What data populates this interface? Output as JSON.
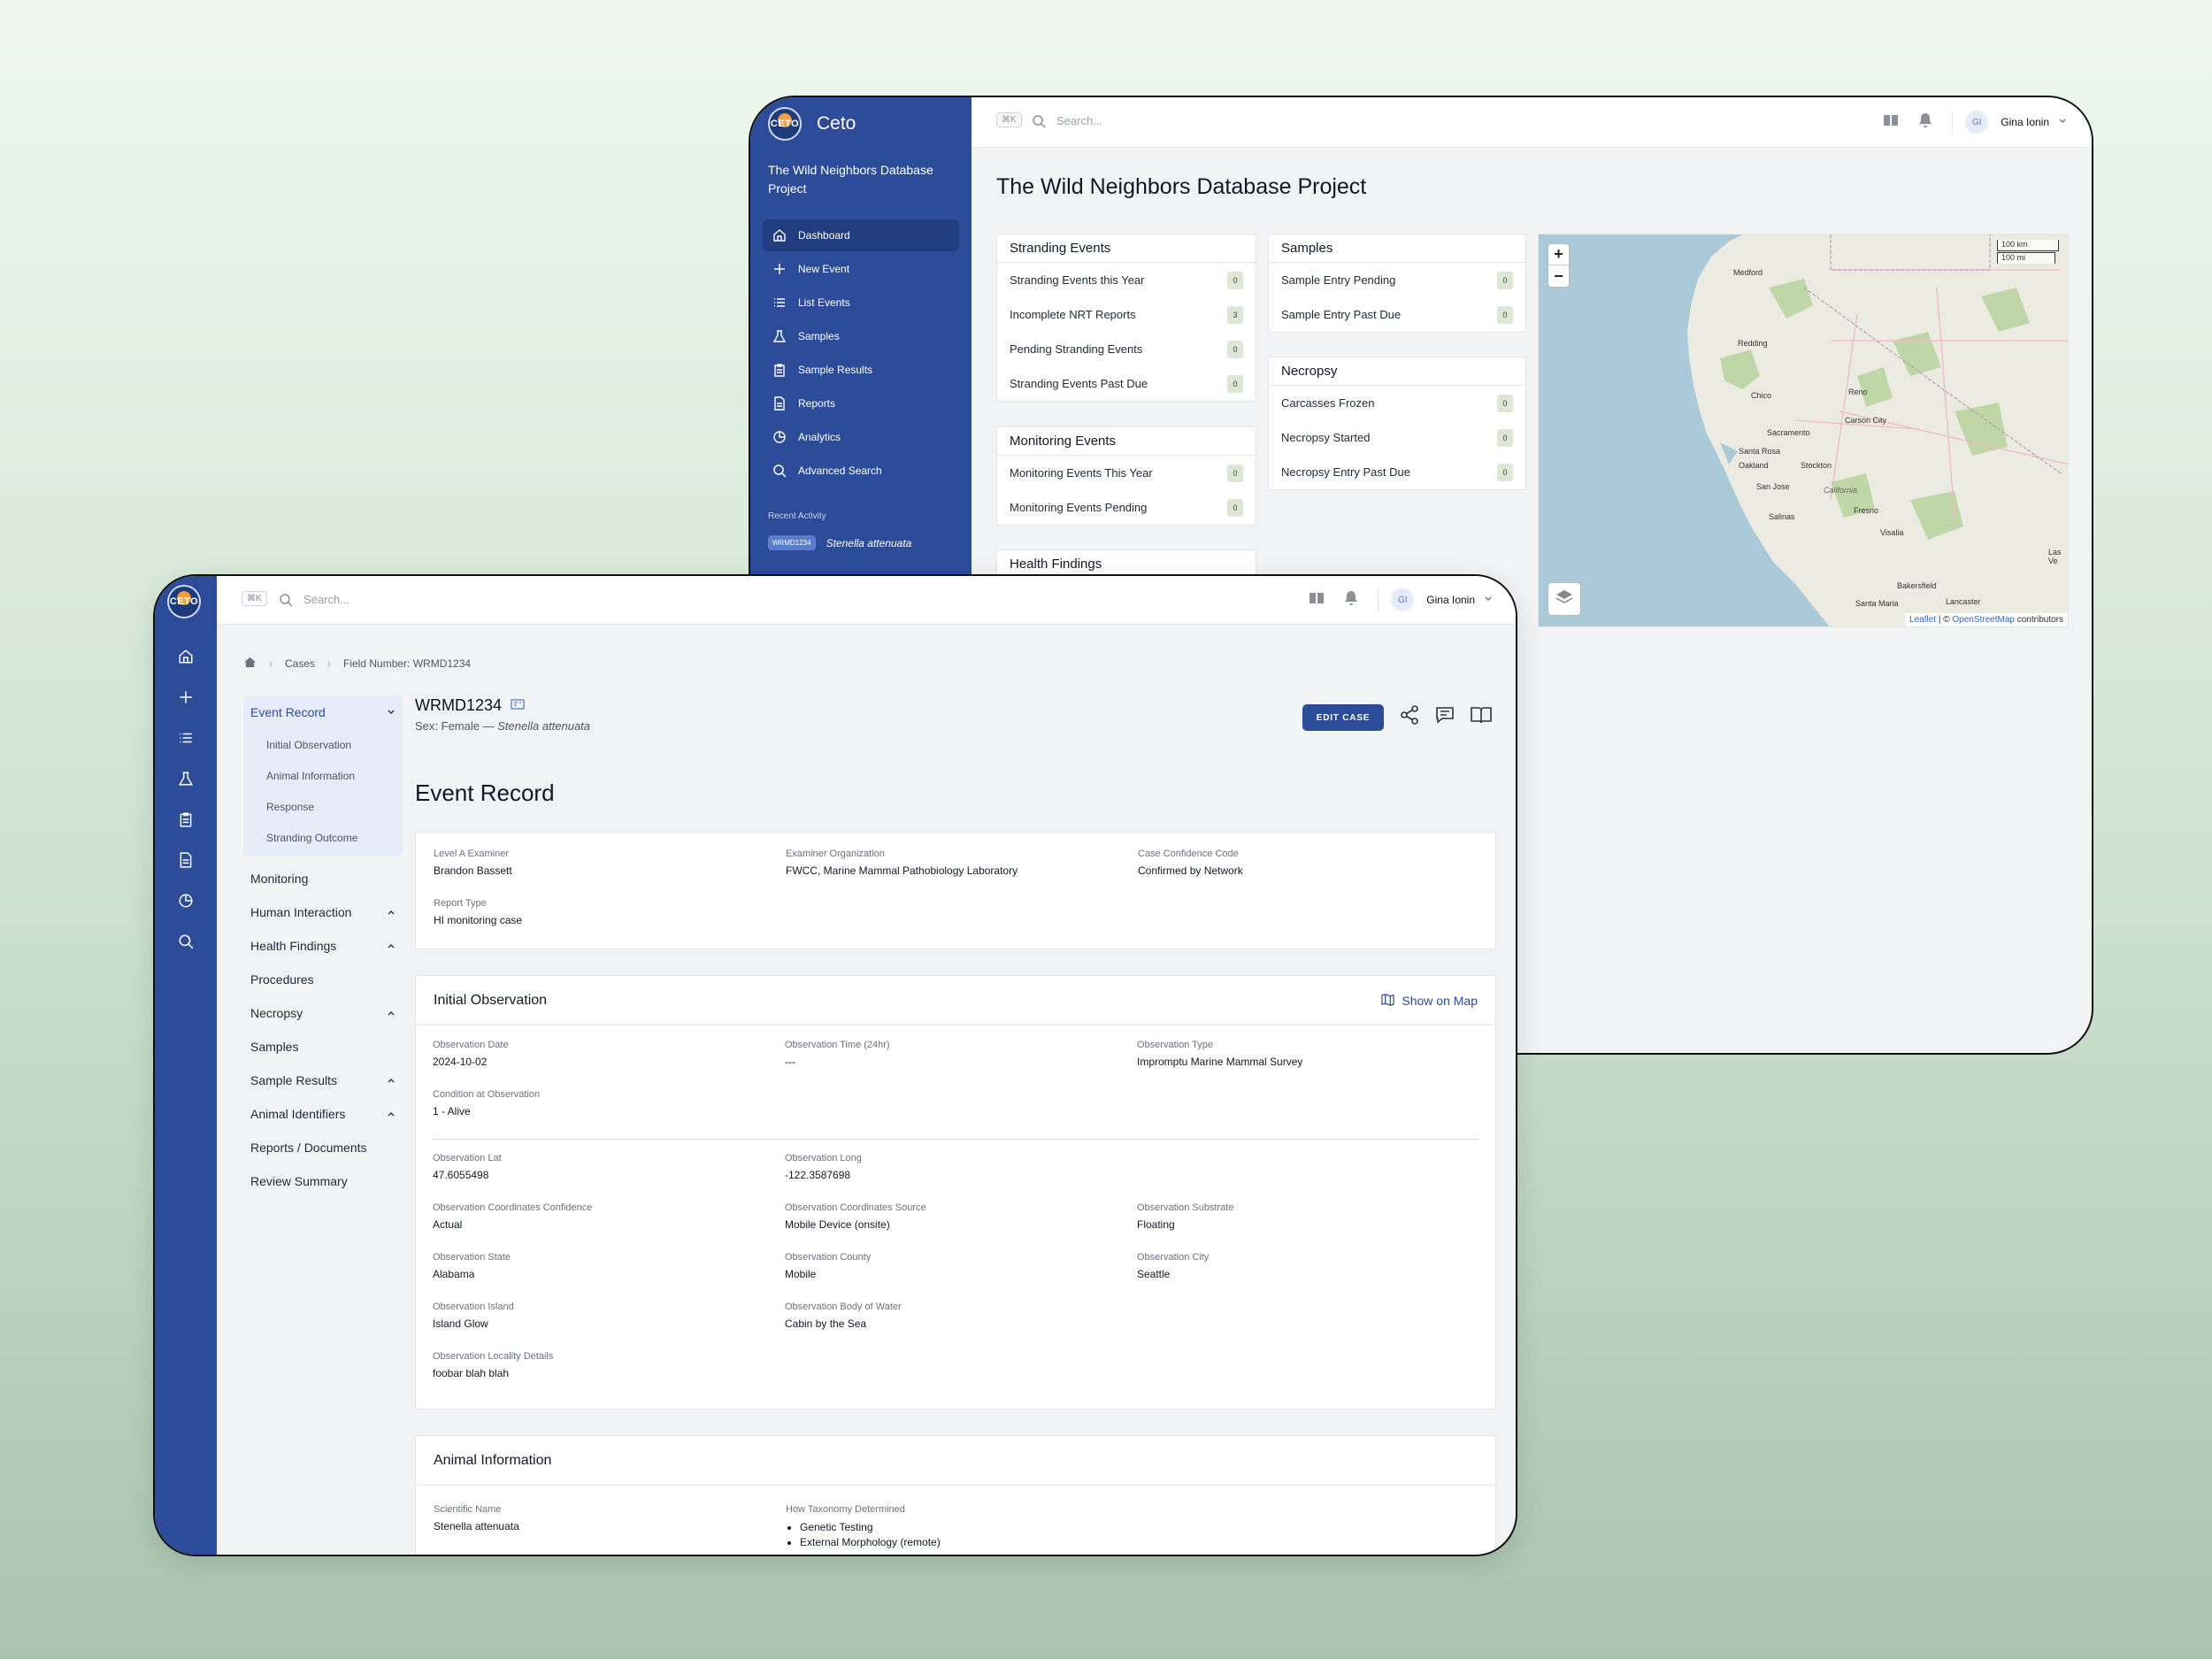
{
  "app": {
    "name": "Ceto",
    "logo_text": "CETO",
    "project": "The Wild Neighbors Database Project"
  },
  "search": {
    "shortcut": "⌘K",
    "placeholder": "Search..."
  },
  "user": {
    "initials": "GI",
    "name": "Gina Ionin"
  },
  "sidebar": {
    "items": [
      {
        "label": "Dashboard",
        "icon": "home-icon"
      },
      {
        "label": "New Event",
        "icon": "plus-icon"
      },
      {
        "label": "List Events",
        "icon": "list-icon"
      },
      {
        "label": "Samples",
        "icon": "flask-icon"
      },
      {
        "label": "Sample Results",
        "icon": "clipboard-icon"
      },
      {
        "label": "Reports",
        "icon": "document-icon"
      },
      {
        "label": "Analytics",
        "icon": "pie-chart-icon"
      },
      {
        "label": "Advanced Search",
        "icon": "search-icon"
      }
    ],
    "recent_heading": "Recent Activity",
    "recent": {
      "tag": "WRMD1234",
      "species": "Stenella attenuata"
    }
  },
  "dashboard": {
    "title": "The Wild Neighbors Database Project",
    "stranding": {
      "title": "Stranding Events",
      "rows": [
        {
          "label": "Stranding Events this Year",
          "count": "0"
        },
        {
          "label": "Incomplete NRT Reports",
          "count": "3"
        },
        {
          "label": "Pending Stranding Events",
          "count": "0"
        },
        {
          "label": "Stranding Events Past Due",
          "count": "0"
        }
      ]
    },
    "monitoring": {
      "title": "Monitoring Events",
      "rows": [
        {
          "label": "Monitoring Events This Year",
          "count": "0"
        },
        {
          "label": "Monitoring Events Pending",
          "count": "0"
        }
      ]
    },
    "health": {
      "title": "Health Findings"
    },
    "samples": {
      "title": "Samples",
      "rows": [
        {
          "label": "Sample Entry Pending",
          "count": "0"
        },
        {
          "label": "Sample Entry Past Due",
          "count": "0"
        }
      ]
    },
    "necropsy": {
      "title": "Necropsy",
      "rows": [
        {
          "label": "Carcasses Frozen",
          "count": "0"
        },
        {
          "label": "Necropsy Started",
          "count": "0"
        },
        {
          "label": "Necropsy Entry Past Due",
          "count": "0"
        }
      ]
    },
    "map": {
      "zoom_in": "+",
      "zoom_out": "−",
      "scale_km": "100 km",
      "scale_mi": "100 mi",
      "attr_leaflet": "Leaflet",
      "attr_sep": "| ©",
      "attr_osm": "OpenStreetMap",
      "attr_tail": "contributors",
      "cities": [
        "Medford",
        "Redding",
        "Chico",
        "Reno",
        "Carson City",
        "Sacramento",
        "Santa Rosa",
        "Oakland",
        "Stockton",
        "San Jose",
        "California",
        "Fresno",
        "Salinas",
        "Visalia",
        "Las Ve",
        "Bakersfield",
        "Santa Maria",
        "Lancaster"
      ]
    }
  },
  "case": {
    "breadcrumb": [
      "Cases",
      "Field Number: WRMD1234"
    ],
    "id": "WRMD1234",
    "sex": "Sex: Female —",
    "species": "Stenella attenuata",
    "edit_label": "EDIT CASE",
    "section_title": "Event Record",
    "nav": {
      "event_record": "Event Record",
      "event_subs": [
        "Initial Observation",
        "Animal Information",
        "Response",
        "Stranding Outcome"
      ],
      "items": [
        {
          "label": "Monitoring",
          "chev": ""
        },
        {
          "label": "Human Interaction",
          "chev": "⌃"
        },
        {
          "label": "Health Findings",
          "chev": "⌃"
        },
        {
          "label": "Procedures",
          "chev": ""
        },
        {
          "label": "Necropsy",
          "chev": "⌃"
        },
        {
          "label": "Samples",
          "chev": ""
        },
        {
          "label": "Sample Results",
          "chev": "⌃"
        },
        {
          "label": "Animal Identifiers",
          "chev": "⌃"
        },
        {
          "label": "Reports / Documents",
          "chev": ""
        },
        {
          "label": "Review Summary",
          "chev": ""
        }
      ]
    },
    "record": {
      "level_a_label": "Level A Examiner",
      "level_a": "Brandon Bassett",
      "org_label": "Examiner Organization",
      "org": "FWCC, Marine Mammal Pathobiology Laboratory",
      "conf_label": "Case Confidence Code",
      "conf": "Confirmed by Network",
      "rtype_label": "Report Type",
      "rtype": "HI monitoring case"
    },
    "initial": {
      "title": "Initial Observation",
      "show_map": "Show on Map",
      "fields": [
        {
          "l": "Observation Date",
          "v": "2024-10-02"
        },
        {
          "l": "Observation Time (24hr)",
          "v": "---"
        },
        {
          "l": "Observation Type",
          "v": "Impromptu Marine Mammal Survey"
        },
        {
          "l": "Condition at Observation",
          "v": "1 - Alive"
        },
        {
          "l": "Observation Lat",
          "v": "47.6055498"
        },
        {
          "l": "Observation Long",
          "v": "-122.3587698"
        },
        {
          "l": "Observation Coordinates Confidence",
          "v": "Actual"
        },
        {
          "l": "Observation Coordinates Source",
          "v": "Mobile Device (onsite)"
        },
        {
          "l": "Observation Substrate",
          "v": "Floating"
        },
        {
          "l": "Observation State",
          "v": "Alabama"
        },
        {
          "l": "Observation County",
          "v": "Mobile"
        },
        {
          "l": "Observation City",
          "v": "Seattle"
        },
        {
          "l": "Observation Island",
          "v": "Island Glow"
        },
        {
          "l": "Observation Body of Water",
          "v": "Cabin by the Sea"
        },
        {
          "l": "Observation Locality Details",
          "v": "foobar blah blah"
        }
      ]
    },
    "animal": {
      "title": "Animal Information",
      "sci_label": "Scientific Name",
      "sci": "Stenella attenuata",
      "tax_label": "How Taxonomy Determined",
      "tax": [
        "Genetic Testing",
        "External Morphology (remote)"
      ]
    }
  }
}
